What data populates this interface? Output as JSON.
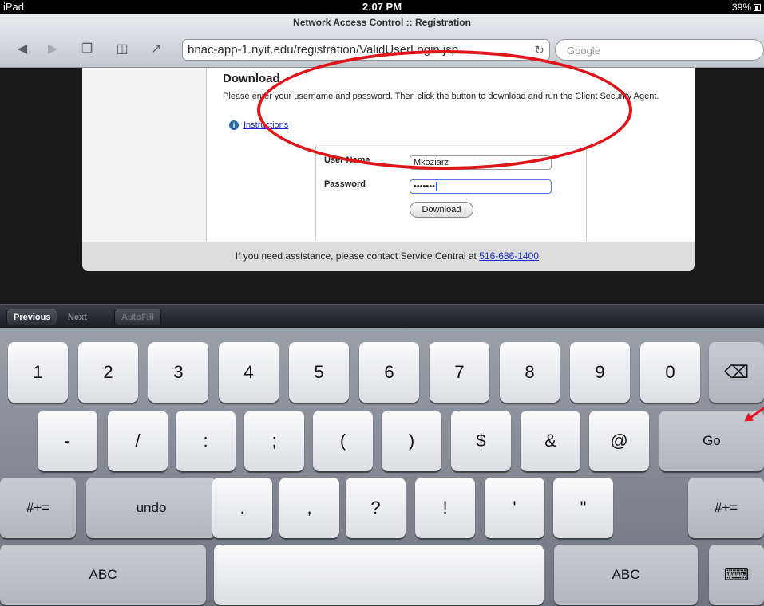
{
  "status": {
    "device": "iPad",
    "time": "2:07 PM",
    "battery": "39%"
  },
  "browser": {
    "page_title": "Network Access Control :: Registration",
    "url": "bnac-app-1.nyit.edu/registration/ValidUserLogin.jsp",
    "search_placeholder": "Google"
  },
  "page": {
    "heading": "Download",
    "instructions_text": "Please enter your username and password. Then click the button to download and run the Client Security Agent.",
    "instructions_link": "Instructions",
    "username_label": "User Name",
    "username_value": "Mkoziarz",
    "password_label": "Password",
    "password_value": "•••••••",
    "download_button": "Download",
    "footer_text": "If you need assistance, please contact Service Central at",
    "footer_phone": "516-686-1400",
    "footer_period": "."
  },
  "formbar": {
    "previous": "Previous",
    "next": "Next",
    "autofill": "AutoFill"
  },
  "keyboard": {
    "row1": [
      "1",
      "2",
      "3",
      "4",
      "5",
      "6",
      "7",
      "8",
      "9",
      "0"
    ],
    "row2": [
      "-",
      "/",
      ":",
      ";",
      "(",
      ")",
      "$",
      "&",
      "@"
    ],
    "go": "Go",
    "row3_left": "#+=",
    "undo": "undo",
    "row3": [
      ".",
      ",",
      "?",
      "!",
      "'",
      "\""
    ],
    "row3_right": "#+=",
    "abc_left": "ABC",
    "abc_right": "ABC"
  },
  "colors": {
    "annotation": "#e1141a",
    "link": "#1a2bd6"
  }
}
